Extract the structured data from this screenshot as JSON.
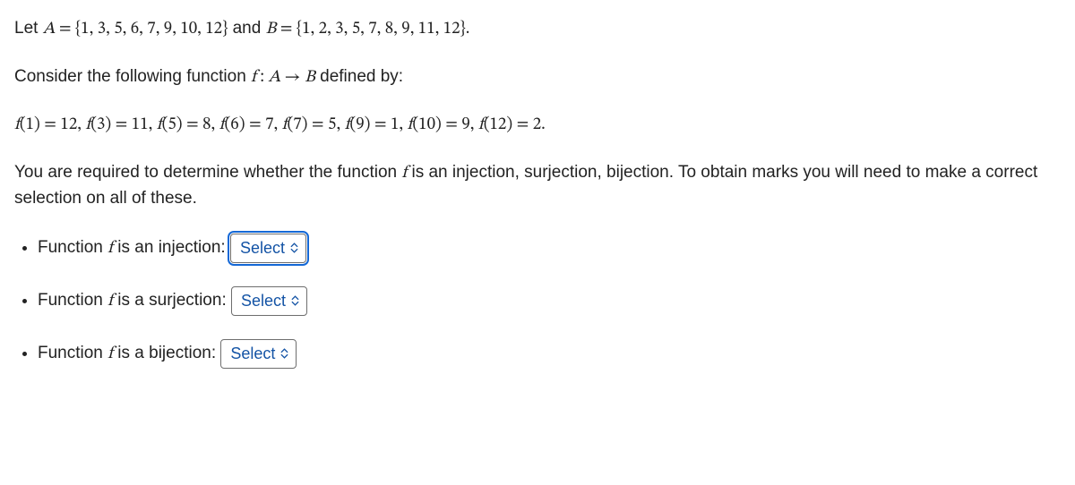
{
  "line1": {
    "pre": "Let ",
    "expr": "A = {1, 3, 5, 6, 7, 9, 10, 12}",
    "mid": " and ",
    "expr2": "B = {1, 2, 3, 5, 7, 8, 9, 11, 12}",
    "post": "."
  },
  "line2": {
    "pre": "Consider the following function   ",
    "expr": "f : A → B",
    "post": "   defined by:"
  },
  "line3": {
    "expr": "f(1) = 12, f(3) = 11, f(5) = 8, f(6) = 7, f(7) = 5, f(9) = 1, f(10) = 9, f(12) = 2."
  },
  "line4": {
    "t1": "You are required to determine whether the function ",
    "f": "f",
    "t2": " is an injection, surjection, bijection. To obtain marks you will need to make a correct selection on all of these."
  },
  "questions": {
    "injection": {
      "pre": "Function ",
      "f": "f",
      "post": " is an injection:"
    },
    "surjection": {
      "pre": "Function ",
      "f": "f",
      "post": " is a surjection:"
    },
    "bijection": {
      "pre": "Function ",
      "f": "f",
      "post": " is a bijection:"
    }
  },
  "select": {
    "placeholder": "Select"
  }
}
